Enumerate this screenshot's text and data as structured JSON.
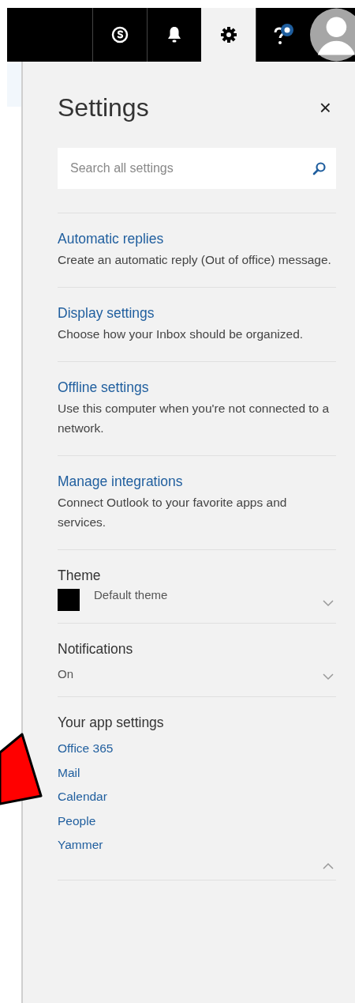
{
  "top_bar": {
    "items": [
      {
        "kind": "skype",
        "selected": false
      },
      {
        "kind": "bell",
        "selected": false
      },
      {
        "kind": "gear",
        "selected": true
      },
      {
        "kind": "help",
        "selected": false
      }
    ]
  },
  "panel": {
    "title": "Settings",
    "close": "×",
    "search": {
      "placeholder": "Search all settings"
    },
    "sections": [
      {
        "kind": "link_item",
        "title": "Automatic replies",
        "description": "Create an automatic reply (Out of office) message."
      },
      {
        "kind": "link_item",
        "title": "Display settings",
        "description": "Choose how your Inbox should be organized."
      },
      {
        "kind": "link_item",
        "title": "Offline settings",
        "description": "Use this computer when you're not connected to a network."
      },
      {
        "kind": "link_item",
        "title": "Manage integrations",
        "description": "Connect Outlook to your favorite apps and services."
      },
      {
        "kind": "dropdown",
        "label": "Theme",
        "value": "Default theme",
        "swatch": true,
        "expanded": false
      },
      {
        "kind": "dropdown",
        "label": "Notifications",
        "value": "On",
        "swatch": false,
        "expanded": false
      },
      {
        "kind": "links",
        "label": "Your app settings",
        "links": [
          "Office 365",
          "Mail",
          "Calendar",
          "People",
          "Yammer"
        ],
        "expanded": true
      }
    ]
  }
}
